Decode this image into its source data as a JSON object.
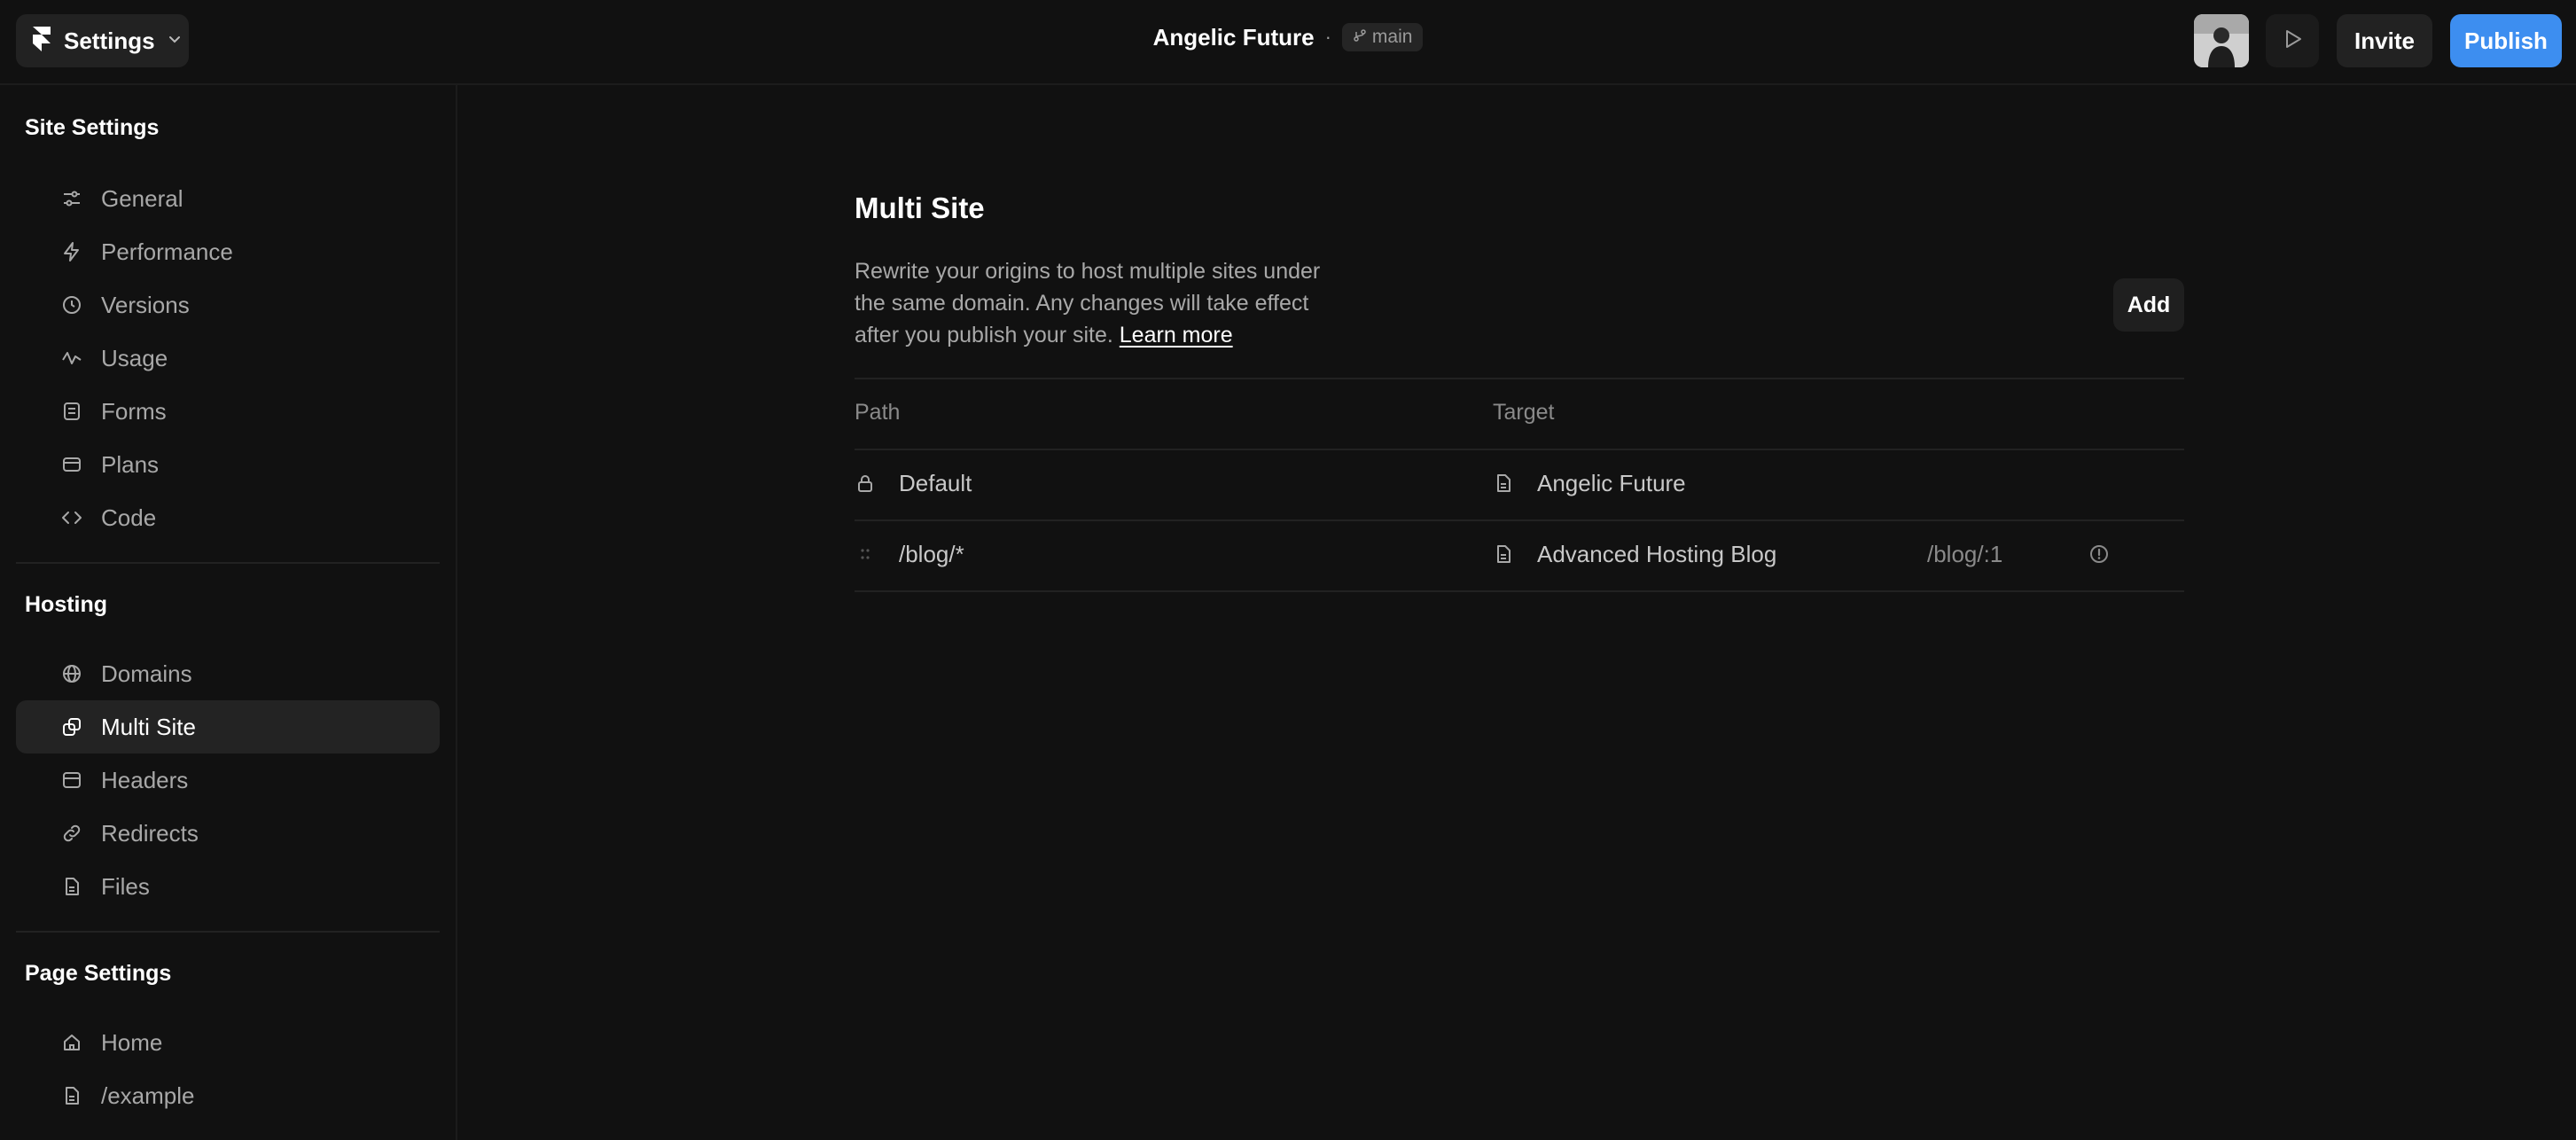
{
  "topbar": {
    "app_menu_label": "Settings",
    "project_name": "Angelic Future",
    "separator": "·",
    "branch": "main",
    "invite_label": "Invite",
    "publish_label": "Publish",
    "accent_color": "#3d8ef0"
  },
  "sidebar": {
    "site_settings_title": "Site Settings",
    "site_settings_items": [
      {
        "label": "General",
        "icon": "sliders-icon"
      },
      {
        "label": "Performance",
        "icon": "bolt-icon"
      },
      {
        "label": "Versions",
        "icon": "clock-icon"
      },
      {
        "label": "Usage",
        "icon": "activity-icon"
      },
      {
        "label": "Forms",
        "icon": "form-icon"
      },
      {
        "label": "Plans",
        "icon": "card-icon"
      },
      {
        "label": "Code",
        "icon": "code-icon"
      }
    ],
    "hosting_title": "Hosting",
    "hosting_items": [
      {
        "label": "Domains",
        "icon": "globe-icon"
      },
      {
        "label": "Multi Site",
        "icon": "copy-icon",
        "active": true
      },
      {
        "label": "Headers",
        "icon": "header-icon"
      },
      {
        "label": "Redirects",
        "icon": "link-icon"
      },
      {
        "label": "Files",
        "icon": "file-icon"
      }
    ],
    "page_settings_title": "Page Settings",
    "page_settings_items": [
      {
        "label": "Home",
        "icon": "home-icon"
      },
      {
        "label": "/example",
        "icon": "file-icon"
      }
    ]
  },
  "main": {
    "title": "Multi Site",
    "description": "Rewrite your origins to host multiple sites under the same domain. Any changes will take effect after you publish your site. ",
    "learn_more": "Learn more",
    "add_label": "Add",
    "columns": {
      "path": "Path",
      "target": "Target"
    },
    "rows": [
      {
        "path": "Default",
        "path_icon": "lock-icon",
        "target": "Angelic Future",
        "target_icon": "file-icon",
        "rewrite": ""
      },
      {
        "path": "/blog/*",
        "path_icon": "drag-handle-icon",
        "target": "Advanced Hosting Blog",
        "target_icon": "file-icon",
        "rewrite": "/blog/:1",
        "status_icon": "warning-circle-icon"
      }
    ]
  }
}
